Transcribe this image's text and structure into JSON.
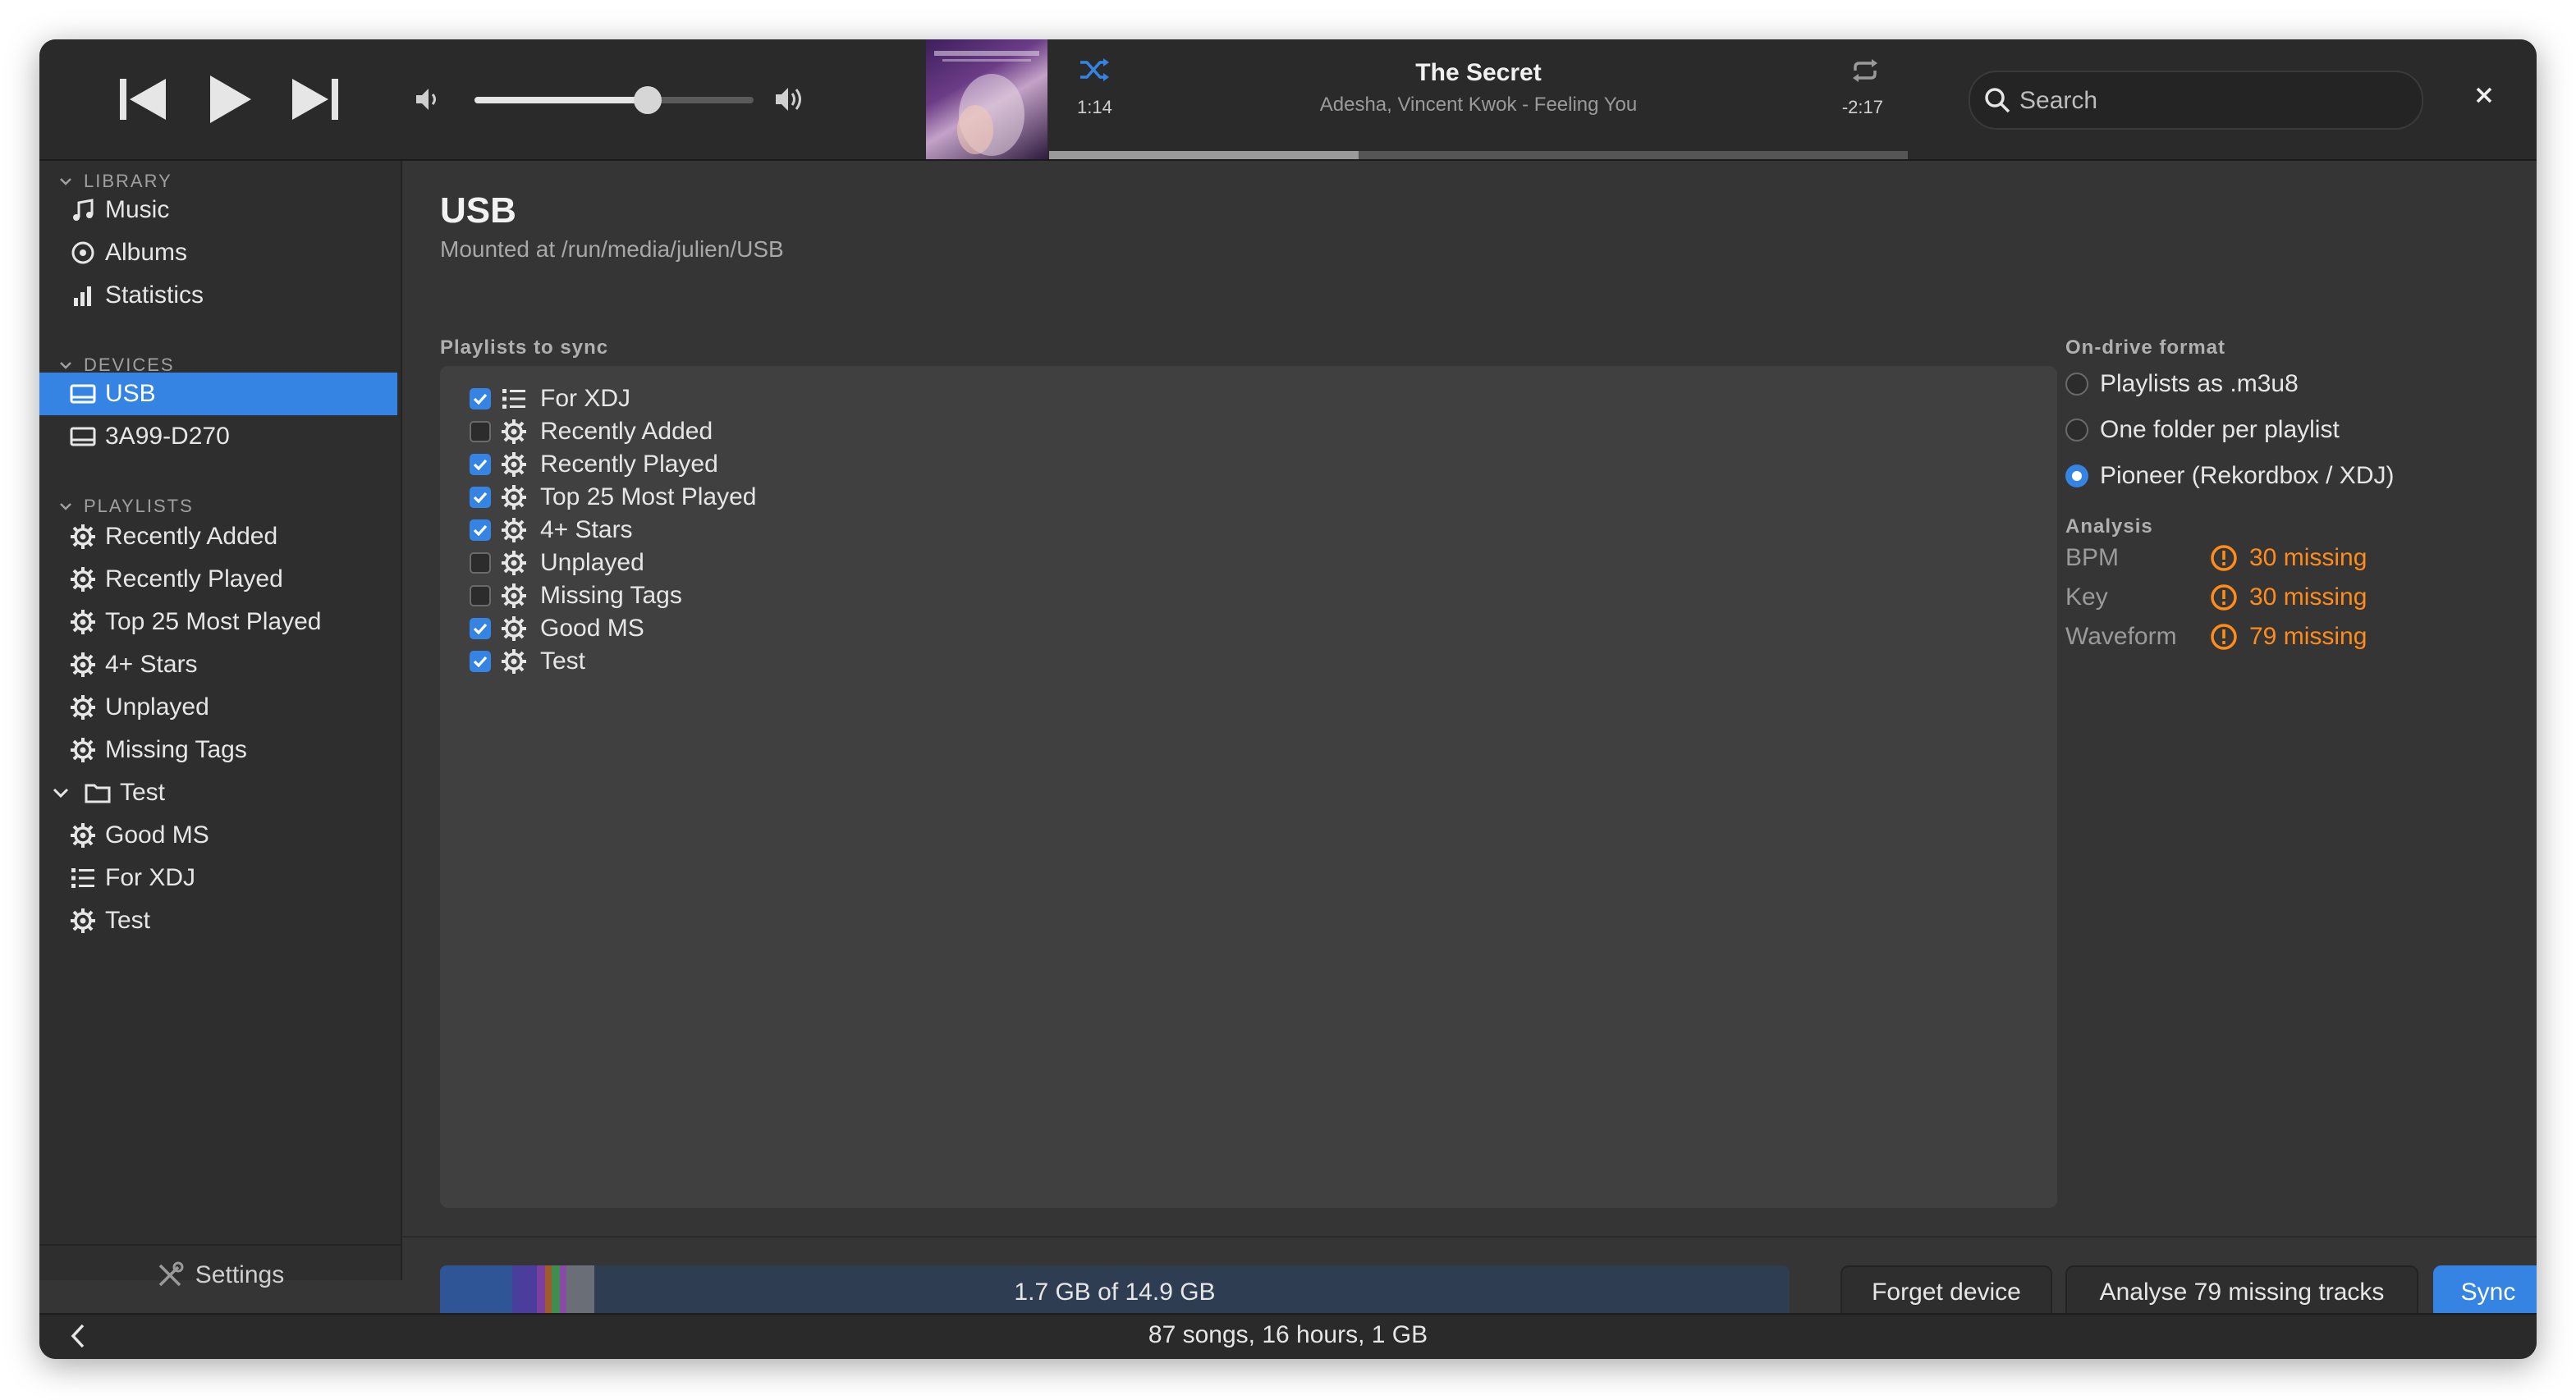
{
  "player": {
    "track_title": "The Secret",
    "track_subtitle": "Adesha, Vincent Kwok - Feeling You",
    "time_elapsed": "1:14",
    "time_remaining": "-2:17",
    "volume_fraction": 0.62,
    "progress_fraction": 0.36,
    "accent": "#3584e4"
  },
  "search": {
    "placeholder": "Search"
  },
  "sidebar": {
    "library": {
      "header": "LIBRARY",
      "items": [
        {
          "label": "Music",
          "icon": "music-note-icon"
        },
        {
          "label": "Albums",
          "icon": "disc-icon"
        },
        {
          "label": "Statistics",
          "icon": "bar-chart-icon"
        }
      ]
    },
    "devices": {
      "header": "DEVICES",
      "items": [
        {
          "label": "USB",
          "icon": "drive-icon",
          "selected": true
        },
        {
          "label": "3A99-D270",
          "icon": "drive-icon"
        }
      ]
    },
    "playlists": {
      "header": "PLAYLISTS",
      "items": [
        {
          "label": "Recently Added",
          "icon": "gear-icon"
        },
        {
          "label": "Recently Played",
          "icon": "gear-icon"
        },
        {
          "label": "Top 25 Most Played",
          "icon": "gear-icon"
        },
        {
          "label": "4+ Stars",
          "icon": "gear-icon"
        },
        {
          "label": "Unplayed",
          "icon": "gear-icon"
        },
        {
          "label": "Missing Tags",
          "icon": "gear-icon"
        }
      ],
      "folder": {
        "label": "Test",
        "icon": "folder-icon",
        "children": [
          {
            "label": "Good MS",
            "icon": "gear-icon"
          },
          {
            "label": "For XDJ",
            "icon": "list-icon"
          },
          {
            "label": "Test",
            "icon": "gear-icon"
          }
        ]
      }
    },
    "settings_label": "Settings"
  },
  "device": {
    "title": "USB",
    "subtitle": "Mounted at /run/media/julien/USB",
    "playlists_label": "Playlists to sync",
    "playlists": [
      {
        "label": "For XDJ",
        "checked": true,
        "icon": "list-icon"
      },
      {
        "label": "Recently Added",
        "checked": false,
        "icon": "gear-icon"
      },
      {
        "label": "Recently Played",
        "checked": true,
        "icon": "gear-icon"
      },
      {
        "label": "Top 25 Most Played",
        "checked": true,
        "icon": "gear-icon"
      },
      {
        "label": "4+ Stars",
        "checked": true,
        "icon": "gear-icon"
      },
      {
        "label": "Unplayed",
        "checked": false,
        "icon": "gear-icon"
      },
      {
        "label": "Missing Tags",
        "checked": false,
        "icon": "gear-icon"
      },
      {
        "label": "Good MS",
        "checked": true,
        "icon": "gear-icon"
      },
      {
        "label": "Test",
        "checked": true,
        "icon": "gear-icon"
      }
    ],
    "format_label": "On-drive format",
    "formats": [
      {
        "label": "Playlists as .m3u8",
        "selected": false
      },
      {
        "label": "One folder per playlist",
        "selected": false
      },
      {
        "label": "Pioneer (Rekordbox / XDJ)",
        "selected": true
      }
    ],
    "analysis_label": "Analysis",
    "analysis": [
      {
        "key": "BPM",
        "value": "30 missing"
      },
      {
        "key": "Key",
        "value": "30 missing"
      },
      {
        "key": "Waveform",
        "value": "79 missing"
      }
    ],
    "warning_color": "#ff8c1a",
    "storage_text": "1.7 GB of 14.9 GB",
    "storage_used_fraction": 0.114,
    "buttons": {
      "forget": "Forget device",
      "analyse": "Analyse 79 missing tracks",
      "sync": "Sync"
    }
  },
  "status": {
    "text": "87 songs, 16 hours, 1 GB"
  }
}
